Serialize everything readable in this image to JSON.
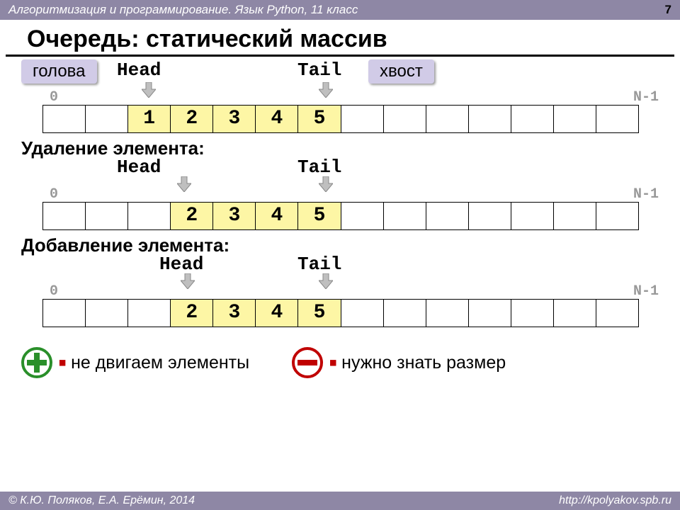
{
  "header": {
    "course": "Алгоритмизация и программирование. Язык Python, 11 класс",
    "page_num": "7"
  },
  "title": "Очередь: статический массив",
  "labels": {
    "head_ru": "голова",
    "tail_ru": "хвост",
    "head": "Head",
    "tail": "Tail",
    "zero": "0",
    "nminus1": "N-1"
  },
  "row1": {
    "cells": [
      "",
      "",
      "1",
      "2",
      "3",
      "4",
      "5",
      "",
      "",
      "",
      "",
      "",
      "",
      ""
    ],
    "fill_from": 2,
    "fill_to": 6
  },
  "del_title": "Удаление элемента:",
  "row2": {
    "cells": [
      "",
      "",
      "",
      "2",
      "3",
      "4",
      "5",
      "",
      "",
      "",
      "",
      "",
      "",
      ""
    ],
    "fill_from": 3,
    "fill_to": 6
  },
  "add_title": "Добавление элемента:",
  "row3": {
    "cells": [
      "",
      "",
      "",
      "2",
      "3",
      "4",
      "5",
      "",
      "",
      "",
      "",
      "",
      "",
      ""
    ],
    "fill_from": 3,
    "fill_to": 6
  },
  "pros": "не двигаем элементы",
  "cons": "нужно знать размер",
  "footer": {
    "authors": "© К.Ю. Поляков, Е.А. Ерёмин, 2014",
    "url": "http://kpolyakov.spb.ru"
  }
}
